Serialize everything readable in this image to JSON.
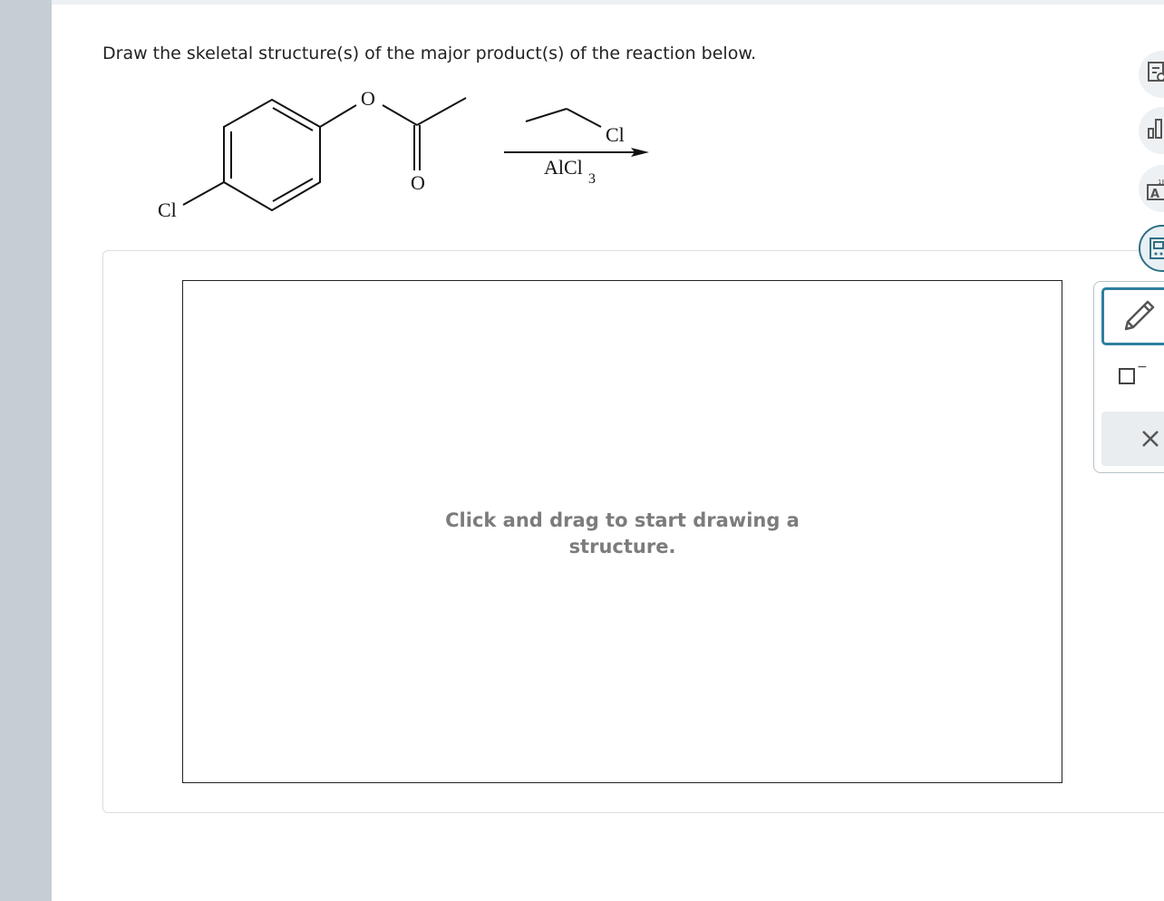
{
  "question": {
    "prompt": "Draw the skeletal structure(s) of the major product(s) of the reaction below."
  },
  "reaction": {
    "reactant_labels": {
      "ester_oxygen": "O",
      "carbonyl_oxygen": "O",
      "chlorine": "Cl"
    },
    "reagent_above": "Cl",
    "reagent_below": "AlCl",
    "reagent_below_subscript": "3"
  },
  "drawing_area": {
    "hint_line1": "Click and drag to start drawing a",
    "hint_line2": "structure."
  },
  "side_tools": {
    "icons": [
      "explanation-icon",
      "data-chart-icon",
      "periodic-table-icon",
      "calculator-icon"
    ],
    "active": "calculator-icon",
    "accent_color": "#2f7fa0"
  },
  "toolbox": {
    "tools": [
      "pencil-icon",
      "charge-icon",
      "clear-icon"
    ],
    "charge_symbol": "−",
    "periodic_icon_number": "18",
    "periodic_icon_letter": "A"
  }
}
